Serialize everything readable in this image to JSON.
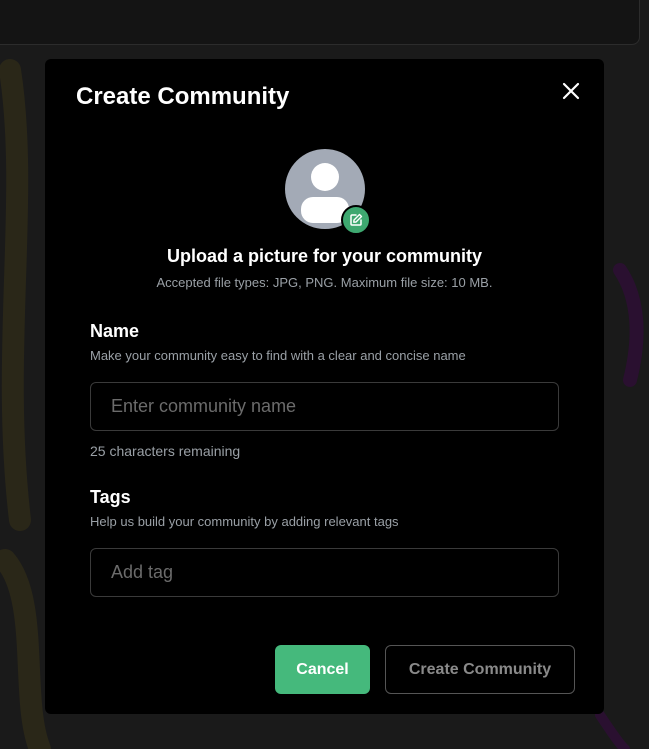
{
  "modal": {
    "title": "Create Community",
    "close_label": "close"
  },
  "upload": {
    "title": "Upload a picture for your community",
    "subtitle": "Accepted file types: JPG, PNG. Maximum file size: 10 MB."
  },
  "name_field": {
    "label": "Name",
    "help": "Make your community easy to find with a clear and concise name",
    "value": "",
    "placeholder": "Enter community name",
    "char_count": "25 characters remaining"
  },
  "tags_field": {
    "label": "Tags",
    "help": "Help us build your community by adding relevant tags",
    "value": "",
    "placeholder": "Add tag"
  },
  "actions": {
    "cancel_label": "Cancel",
    "create_label": "Create Community"
  },
  "colors": {
    "accent": "#45b97c",
    "modal_bg": "#000000",
    "backdrop": "#1a1a1a"
  },
  "icons": {
    "close": "close-icon",
    "avatar": "user-avatar-icon",
    "edit": "edit-icon"
  }
}
